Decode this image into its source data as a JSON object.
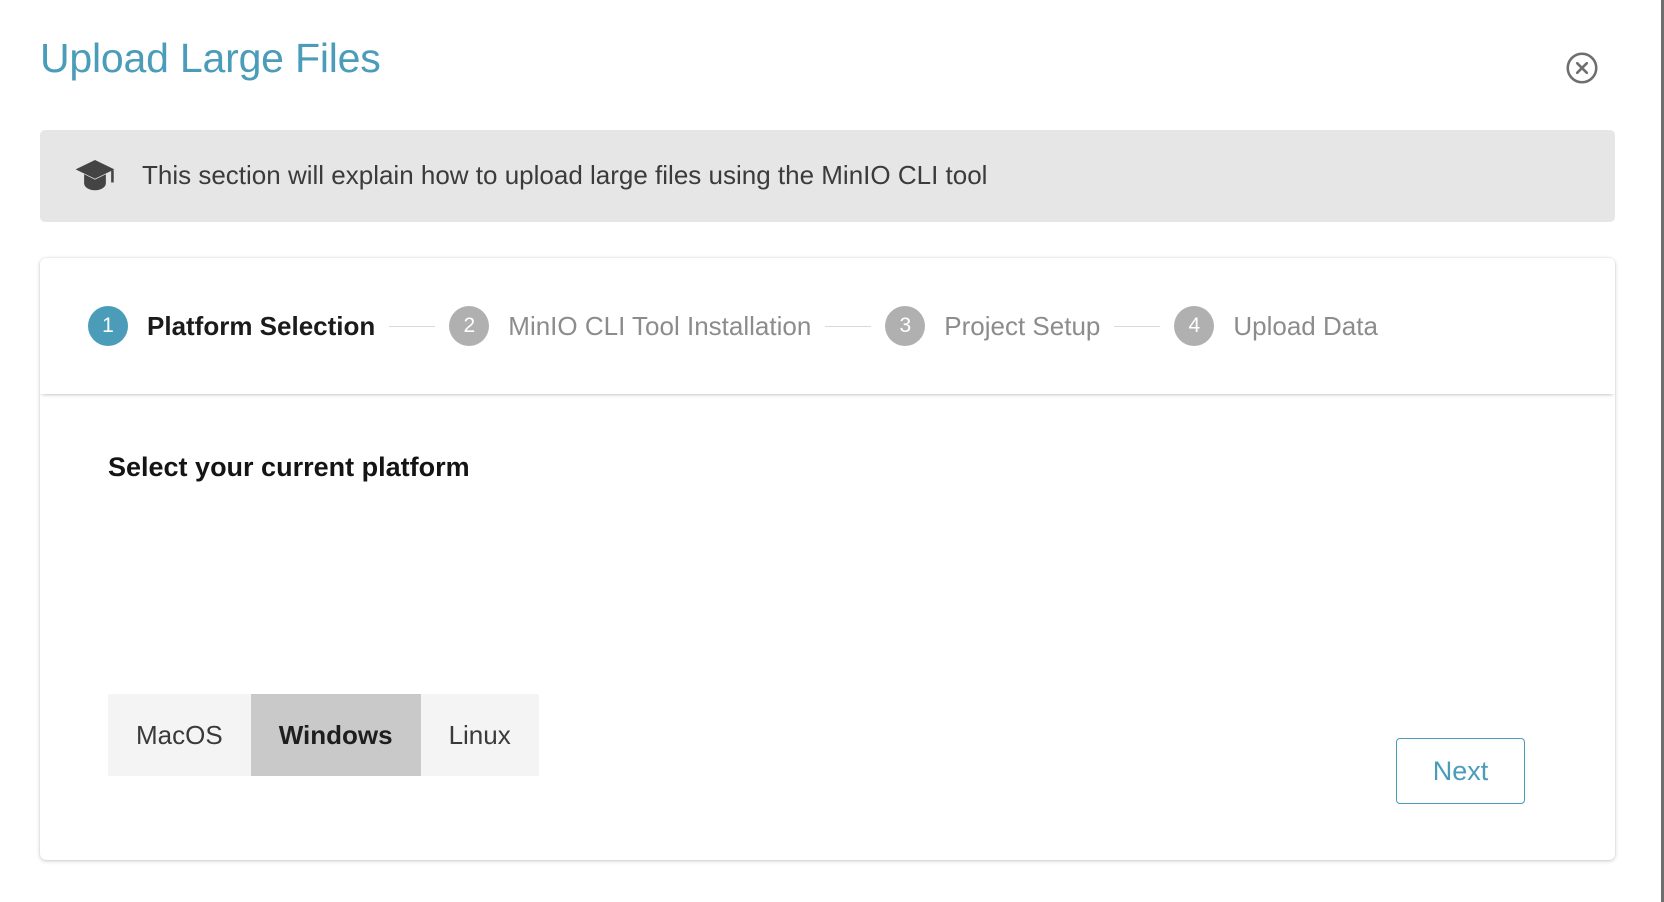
{
  "window": {
    "title": "Upload Large Files",
    "title_color": "#4a9cb9",
    "close_icon": "close-circle-icon"
  },
  "info_banner": {
    "icon": "graduation-cap-icon",
    "text": "This section will explain how to upload large files using the MinIO CLI tool",
    "background": "#e6e6e6"
  },
  "stepper": {
    "active_step": 1,
    "active_color": "#4a9cb9",
    "inactive_color": "#b0b0b0",
    "steps": [
      {
        "number": "1",
        "label": "Platform Selection",
        "state": "active"
      },
      {
        "number": "2",
        "label": "MinIO CLI Tool Installation",
        "state": "inactive"
      },
      {
        "number": "3",
        "label": "Project Setup",
        "state": "inactive"
      },
      {
        "number": "4",
        "label": "Upload Data",
        "state": "inactive"
      }
    ]
  },
  "content": {
    "heading": "Select your current platform",
    "platforms": [
      {
        "label": "MacOS",
        "selected": false
      },
      {
        "label": "Windows",
        "selected": true
      },
      {
        "label": "Linux",
        "selected": false
      }
    ],
    "selected_platform": "Windows",
    "next_label": "Next",
    "next_color": "#4a9cb9"
  }
}
